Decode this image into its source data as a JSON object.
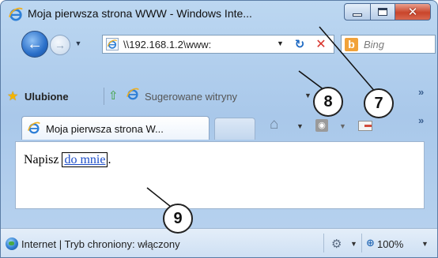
{
  "window": {
    "title": "Moja pierwsza strona WWW - Windows Inte...",
    "minimize_glyph": "",
    "close_glyph": "✕"
  },
  "navigation": {
    "back_glyph": "←",
    "forward_glyph": "→",
    "dropdown_glyph": "▼",
    "address": "\\\\192.168.1.2\\www:",
    "refresh_glyph": "↻",
    "stop_glyph": "✕",
    "search_logo": "b",
    "search_placeholder": "Bing"
  },
  "favorites_bar": {
    "favorites_label": "Ulubione",
    "suggested_label": "Sugerowane witryny",
    "chevron": "»"
  },
  "tabs": {
    "active_tab_title": "Moja pierwsza strona W...",
    "home_glyph": "⌂",
    "feed_glyph": "◉",
    "chevron": "»"
  },
  "page": {
    "text_before": "Napisz ",
    "link_text": "do mnie",
    "text_after": "."
  },
  "status_bar": {
    "zone_text": "Internet | Tryb chroniony: włączony",
    "protect_glyph": "⚙",
    "zoom_glyph": "⊕",
    "zoom_level": "100%"
  },
  "callouts": [
    "7",
    "8",
    "9"
  ],
  "colors": {
    "chrome_blue": "#a9c8ea",
    "link_blue": "#1e4ec8",
    "close_red": "#c9452b",
    "stop_red": "#d8322a",
    "bing_orange": "#f1a23a"
  }
}
